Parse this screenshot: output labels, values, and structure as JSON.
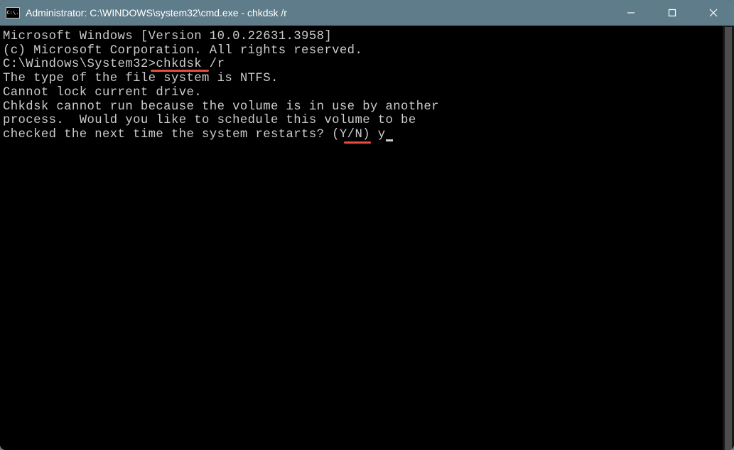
{
  "titlebar": {
    "icon_text": "C:\\.",
    "title": "Administrator: C:\\WINDOWS\\system32\\cmd.exe - chkdsk  /r"
  },
  "terminal": {
    "line1": "Microsoft Windows [Version 10.0.22631.3958]",
    "line2": "(c) Microsoft Corporation. All rights reserved.",
    "blank1": "",
    "prompt_line": "C:\\Windows\\System32>chkdsk /r",
    "line4": "The type of the file system is NTFS.",
    "line5": "Cannot lock current drive.",
    "blank2": "",
    "line6": "Chkdsk cannot run because the volume is in use by another",
    "line7": "process.  Would you like to schedule this volume to be",
    "line8_prefix": "checked the next time the system restarts? (Y/N) ",
    "line8_input": "y"
  }
}
